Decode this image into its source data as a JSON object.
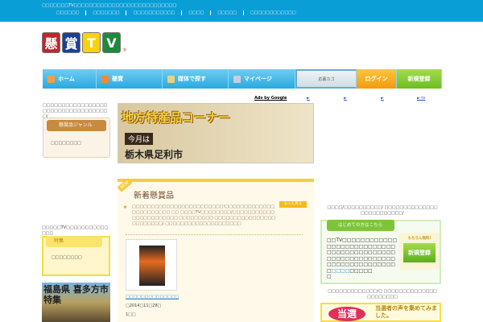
{
  "topbar": {
    "tagline": "□□□□□□□TV□□□□□□□□□□□□□□□□□□□□□□□□□□□",
    "links": [
      "□□□□□□",
      "□□□□□□□",
      "□□□□□□□□□□□",
      "□□□□",
      "□□□□□",
      "□□□□□□□□□□□□"
    ]
  },
  "logo": {
    "chars": [
      "懸",
      "賞",
      "T",
      "V"
    ],
    "reg": "®"
  },
  "nav": {
    "home": "ホーム",
    "prize": "懸賞",
    "media": "媒体で探す",
    "mypage": "マイページ",
    "cart": "応募カゴ",
    "login": "ログイン",
    "register": "新規登録"
  },
  "ads": {
    "label": "Ads by Google",
    "links": [
      "►",
      "►",
      "►",
      "► tv"
    ]
  },
  "left": {
    "intro": "□□□□□□□□□□□□□□□□□□□□□□□□□□□□□□□□□□□/",
    "genre_title": "懸賞品ジャンル",
    "genre_item": "□□□□□□□□",
    "tv_text": "□□□□□TV□□□□□□□□□□□□□□",
    "special_title": "特集",
    "special_item": "□□□□□□□□",
    "fukushima_banner": "福島県 喜多方市特集"
  },
  "banner": {
    "heading": "地方特産品コーナー",
    "month": "今月は",
    "city": "栃木県足利市"
  },
  "new_prizes": {
    "ribbon": "NEW",
    "title": "新着懸賞品",
    "more": "もっと見る",
    "desc": "□□□□□□□□□□□□□□□□□□□□□□□□!□□□□□□□□□□□□□□□□□□□□□□□ □□ □□□□TV□□□□□□□□/□□□□□□□□□□□□□□□□□□□□□□□ □□□□□□□□□ □□□□□□□□□□□□□□□□□□□□□□□□/ □□□□□□□□□□□□□□□□□□□□",
    "item_link": "□□□□□□□□□□□□□□",
    "item_date": "□2014□11□28□",
    "item_count": "1□□"
  },
  "right": {
    "intro": "□□□□/□□□□□□□□□□/ □□□□□□□□□□□□□□□□□□□□□□□□□/",
    "first_title": "はじめての方はこちら",
    "first_text": "□□TV□□□□□□□□□□□□□□□□□□□□□□□□□□□□□□□□□□□□□□□□□□□□□□□□□□□□□□□□□□□□□□□□□□□□□□□□□",
    "first_link": "□□□□",
    "first_tail": "□□□□□",
    "first_end": "□",
    "free": "もちろん無料!",
    "register": "新規登録",
    "voice_intro": "□□□□□□□□□□□□□/□ □□□□□□□□□□□□□□□□□□□□□□",
    "voice_badge": "当選",
    "voice_text": "当選者の声を集めてみました。"
  }
}
